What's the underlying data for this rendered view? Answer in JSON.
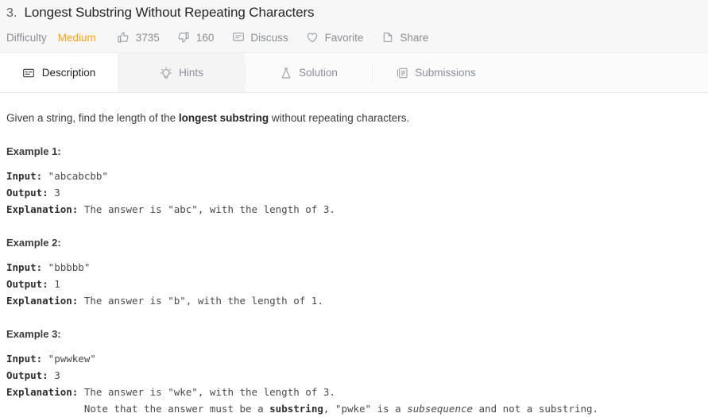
{
  "header": {
    "question_number": "3.",
    "title": "Longest Substring Without Repeating Characters",
    "meta": {
      "difficulty_label": "Difficulty",
      "difficulty_value": "Medium",
      "difficulty_color": "#ffa116",
      "likes_icon": "thumbs-up-icon",
      "likes_count": "3735",
      "dislikes_icon": "thumbs-down-icon",
      "dislikes_count": "160",
      "discuss_icon": "comment-icon",
      "discuss_label": "Discuss",
      "favorite_icon": "heart-icon",
      "favorite_label": "Favorite",
      "share_icon": "share-icon",
      "share_label": "Share"
    }
  },
  "tabs": [
    {
      "id": "description",
      "label": "Description",
      "icon": "description-icon",
      "state": "active"
    },
    {
      "id": "hints",
      "label": "Hints",
      "icon": "lightbulb-icon",
      "state": "hovered"
    },
    {
      "id": "solution",
      "label": "Solution",
      "icon": "flask-icon",
      "state": "default"
    },
    {
      "id": "submissions",
      "label": "Submissions",
      "icon": "submissions-icon",
      "state": "default"
    }
  ],
  "content": {
    "intro": {
      "before": "Given a string, find the length of the ",
      "bold": "longest substring",
      "after": " without repeating characters."
    },
    "examples": [
      {
        "heading": "Example 1:",
        "input_label": "Input:",
        "input_value": " \"abcabcbb\"",
        "output_label": "Output:",
        "output_value": " 3",
        "explanation_label": "Explanation:",
        "explanation_value": " The answer is \"abc\", with the length of 3."
      },
      {
        "heading": "Example 2:",
        "input_label": "Input:",
        "input_value": " \"bbbbb\"",
        "output_label": "Output:",
        "output_value": " 1",
        "explanation_label": "Explanation:",
        "explanation_value": " The answer is \"b\", with the length of 1."
      },
      {
        "heading": "Example 3:",
        "input_label": "Input:",
        "input_value": " \"pwwkew\"",
        "output_label": "Output:",
        "output_value": " 3",
        "explanation_label": "Explanation:",
        "explanation_value": " The answer is \"wke\", with the length of 3.",
        "note": {
          "indent": "             ",
          "part1": "Note that the answer must be a ",
          "bold": "substring",
          "part2": ", \"pwke\" is a ",
          "italic": "subsequence",
          "part3": " and not a substring."
        }
      }
    ]
  }
}
